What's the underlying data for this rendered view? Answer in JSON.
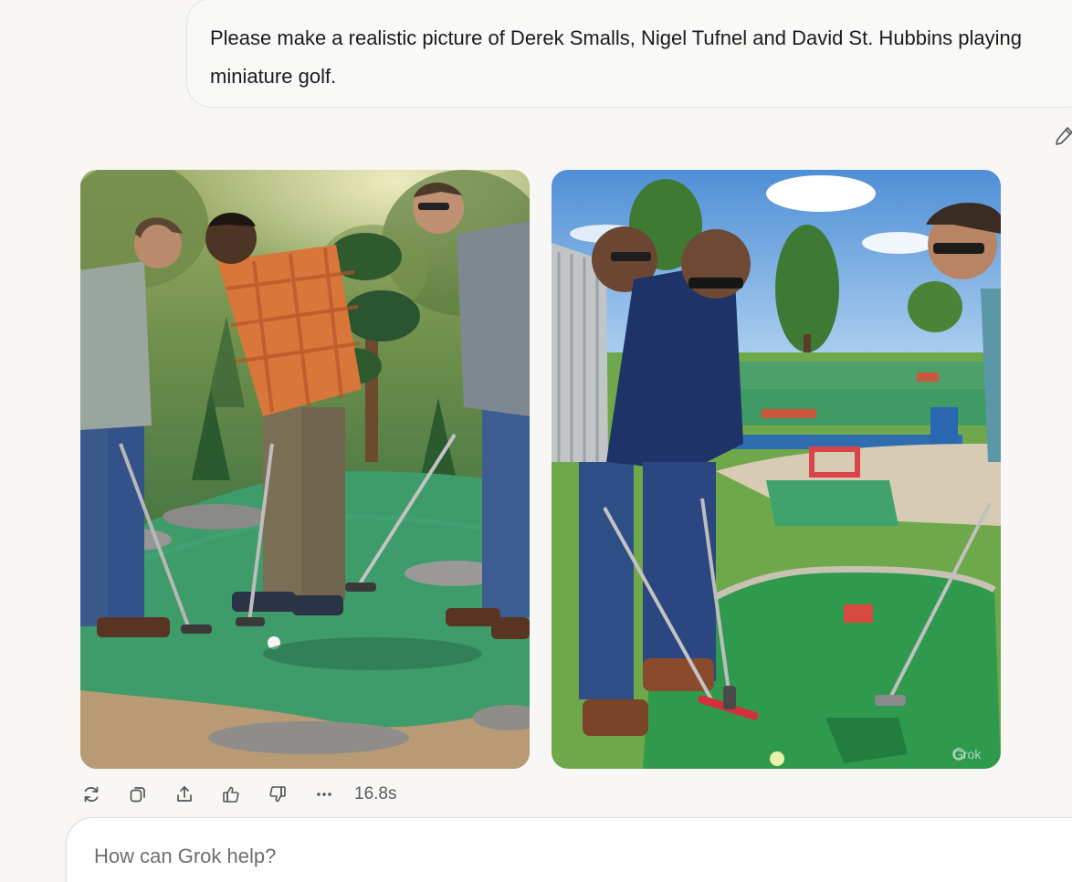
{
  "conversation": {
    "user_message": "Please make a realistic picture of Derek Smalls, Nigel Tufnel and David St. Hubbins playing miniature golf.",
    "edit_icon": "pencil-icon"
  },
  "response": {
    "images": [
      {
        "description_icon": "generated-image"
      },
      {
        "description_icon": "generated-image",
        "watermark": "Grok"
      }
    ],
    "actions": [
      {
        "name": "regenerate",
        "icon": "refresh-icon"
      },
      {
        "name": "copy",
        "icon": "copy-icon"
      },
      {
        "name": "share",
        "icon": "share-icon"
      },
      {
        "name": "like",
        "icon": "thumbs-up-icon"
      },
      {
        "name": "dislike",
        "icon": "thumbs-down-icon"
      },
      {
        "name": "more",
        "icon": "more-icon"
      }
    ],
    "response_time": "16.8s"
  },
  "composer": {
    "placeholder": "How can Grok help?"
  }
}
